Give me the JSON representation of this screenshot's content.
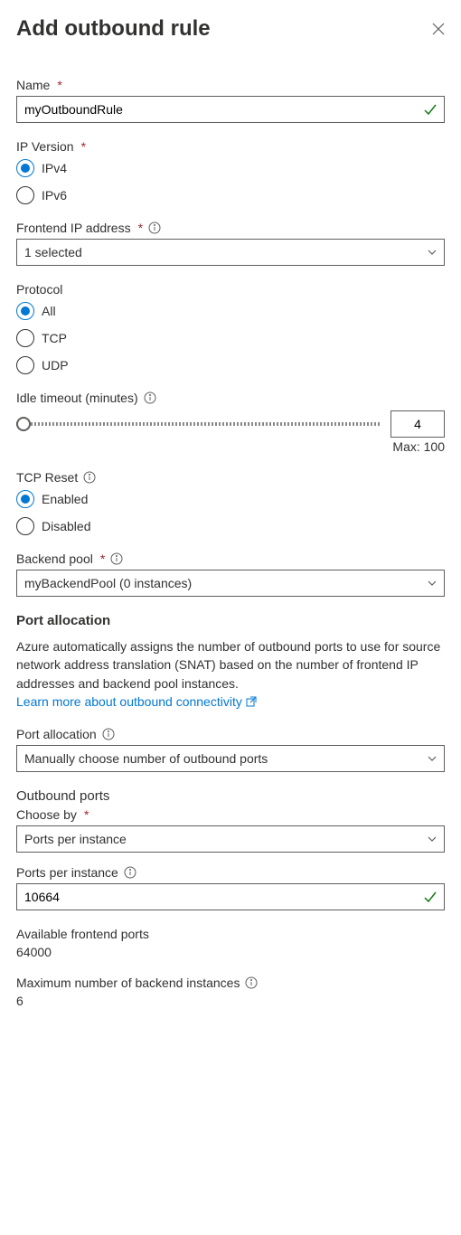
{
  "header": {
    "title": "Add outbound rule"
  },
  "name": {
    "label": "Name",
    "value": "myOutboundRule"
  },
  "ipVersion": {
    "label": "IP Version",
    "options": [
      "IPv4",
      "IPv6"
    ],
    "selected": "IPv4"
  },
  "frontendIp": {
    "label": "Frontend IP address",
    "value": "1 selected"
  },
  "protocol": {
    "label": "Protocol",
    "options": [
      "All",
      "TCP",
      "UDP"
    ],
    "selected": "All"
  },
  "idleTimeout": {
    "label": "Idle timeout (minutes)",
    "value": "4",
    "maxLabel": "Max: 100"
  },
  "tcpReset": {
    "label": "TCP Reset",
    "options": [
      "Enabled",
      "Disabled"
    ],
    "selected": "Enabled"
  },
  "backendPool": {
    "label": "Backend pool",
    "value": "myBackendPool (0 instances)"
  },
  "portAllocation": {
    "title": "Port allocation",
    "help": "Azure automatically assigns the number of outbound ports to use for source network address translation (SNAT) based on the number of frontend IP addresses and backend pool instances.",
    "linkText": "Learn more about outbound connectivity",
    "label": "Port allocation",
    "value": "Manually choose number of outbound ports"
  },
  "outboundPorts": {
    "title": "Outbound ports",
    "chooseBy": {
      "label": "Choose by",
      "value": "Ports per instance"
    },
    "portsPerInstance": {
      "label": "Ports per instance",
      "value": "10664"
    },
    "availablePorts": {
      "label": "Available frontend ports",
      "value": "64000"
    },
    "maxInstances": {
      "label": "Maximum number of backend instances",
      "value": "6"
    }
  }
}
